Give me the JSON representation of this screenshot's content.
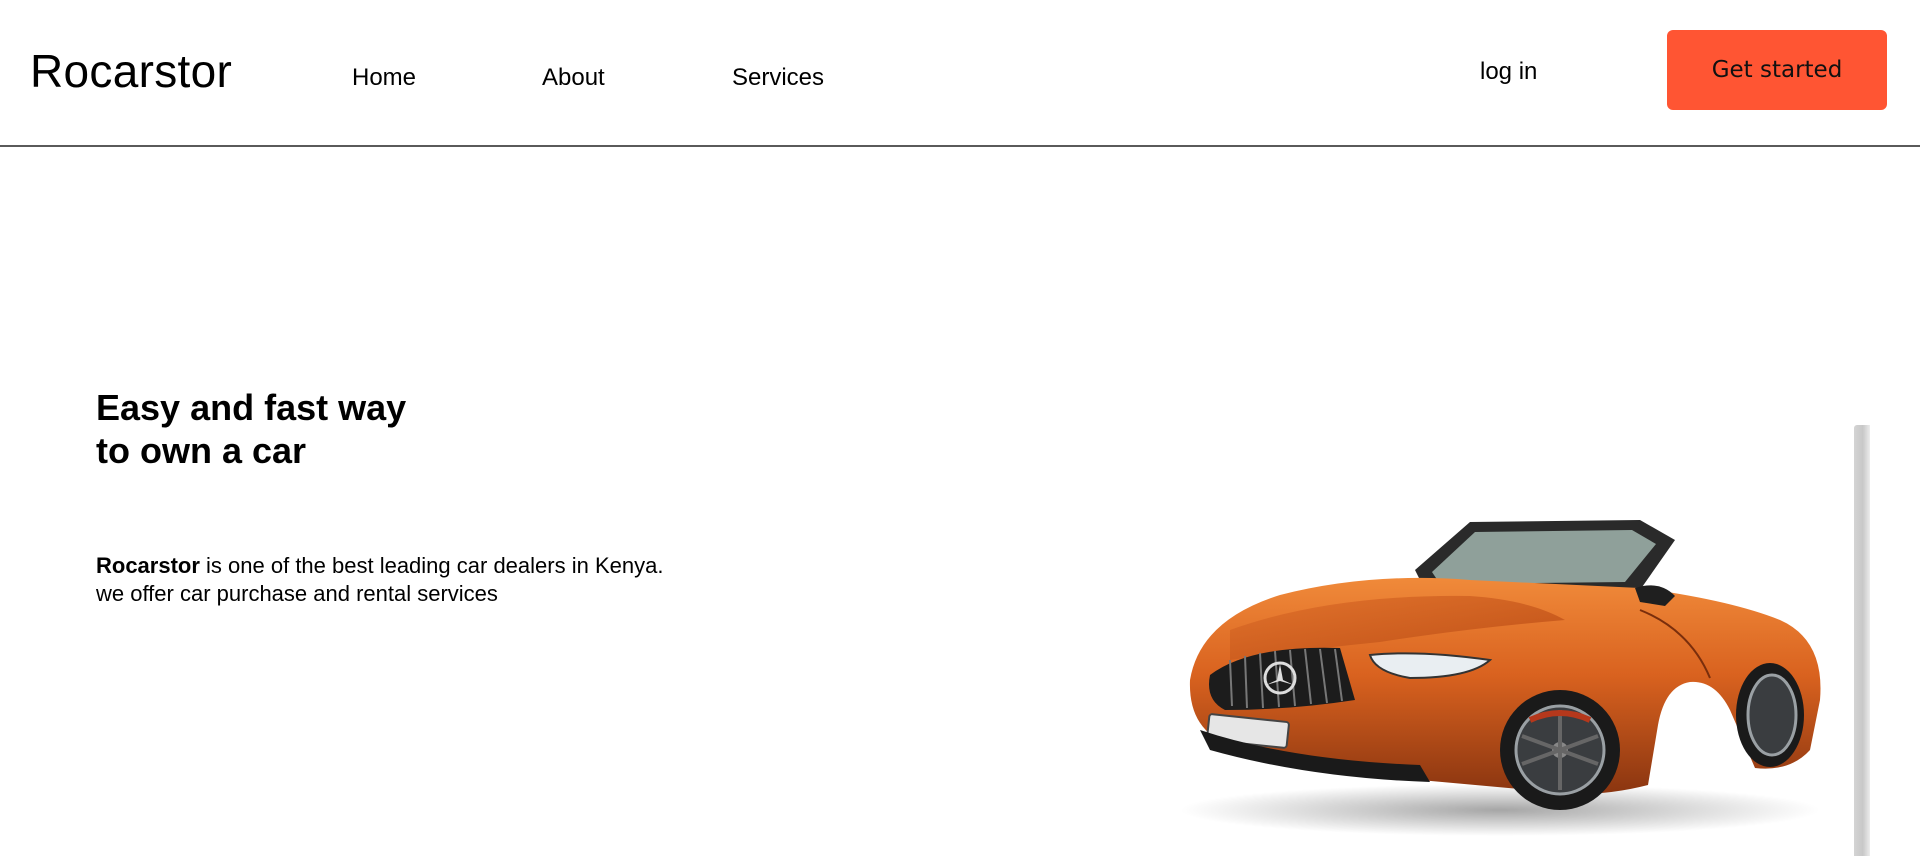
{
  "nav": {
    "brand": "Rocarstor",
    "links": [
      {
        "label": "Home"
      },
      {
        "label": "About"
      },
      {
        "label": "Services"
      }
    ],
    "login_label": "log in",
    "cta_label": "Get started",
    "cta_color": "#ff5533"
  },
  "hero": {
    "title_line1": "Easy and fast way",
    "title_line2": "to own a car",
    "description_brand": "Rocarstor",
    "description_rest": " is one of the best leading car dealers in Kenya.",
    "description_line2": "we offer car purchase and rental services",
    "car_color": "#d9621f"
  }
}
